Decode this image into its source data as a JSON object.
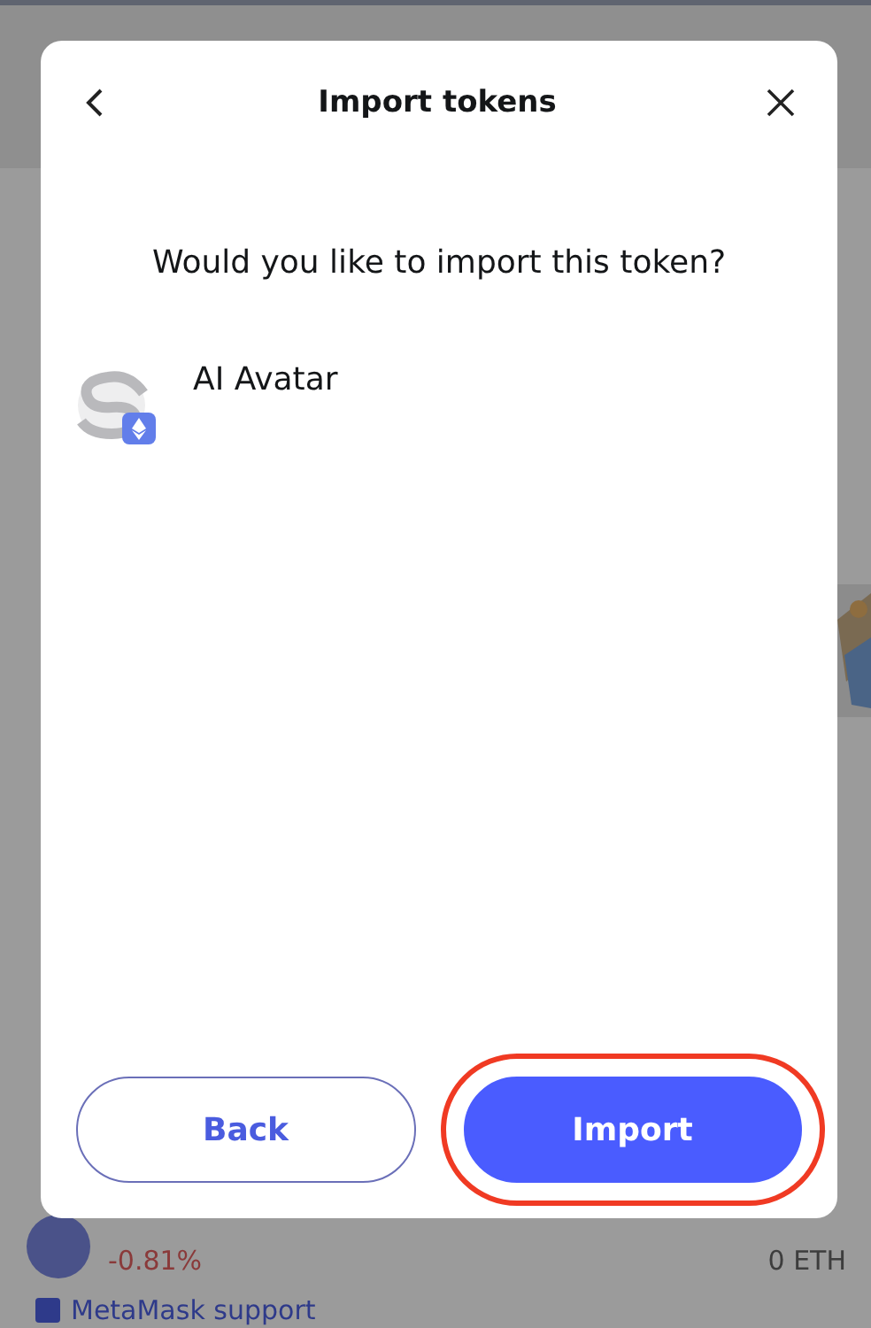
{
  "dialog": {
    "title": "Import tokens",
    "question": "Would you like to import this token?",
    "token": {
      "name": "AI Avatar"
    },
    "buttons": [
      {
        "label": "Back",
        "kind": "secondary",
        "highlighted": false
      },
      {
        "label": "Import",
        "kind": "primary",
        "highlighted": true
      }
    ]
  },
  "background": {
    "change": "-0.81%",
    "balance": "0 ETH",
    "support_link": "MetaMask support"
  }
}
